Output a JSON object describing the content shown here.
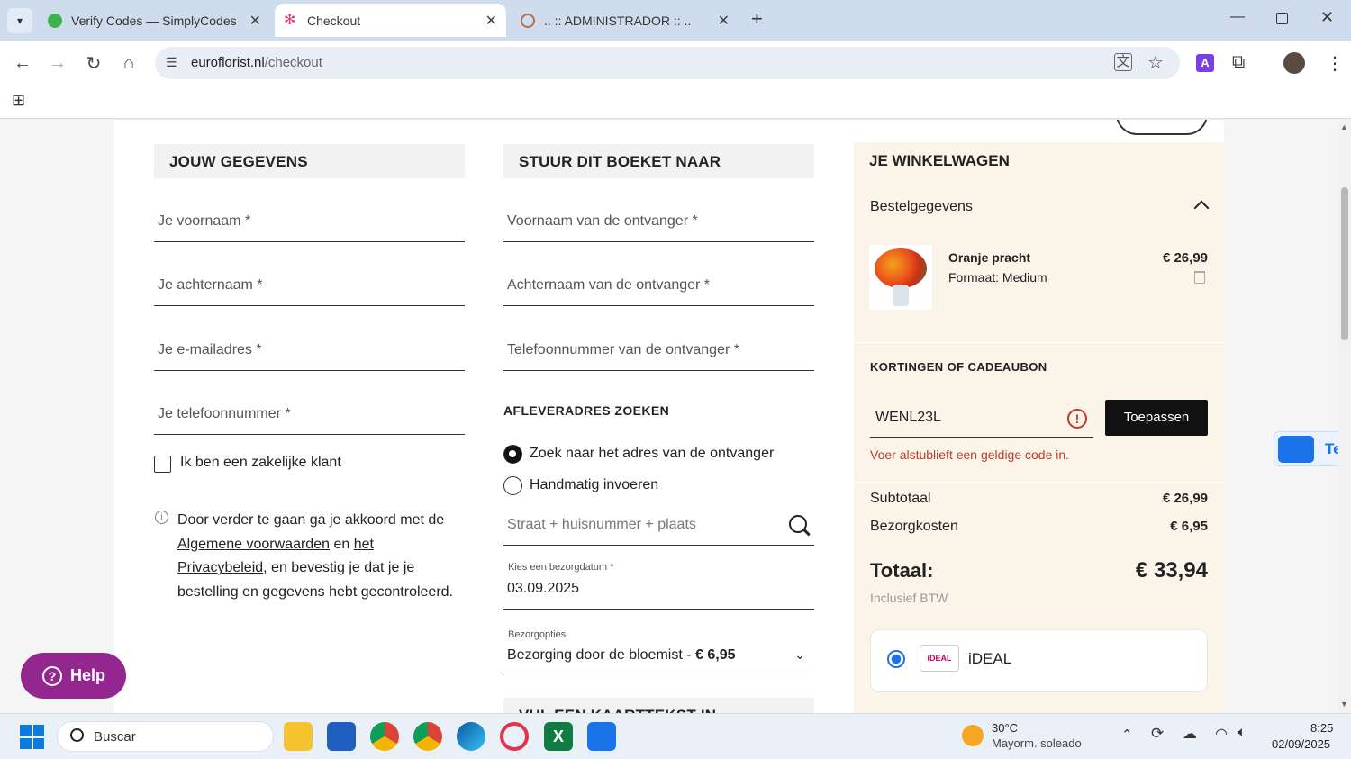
{
  "browser": {
    "tabs": [
      {
        "title": "Verify Codes — SimplyCodes"
      },
      {
        "title": "Checkout"
      },
      {
        "title": ".. :: ADMINISTRADOR :: .."
      }
    ],
    "url_host": "euroflorist.nl",
    "url_path": "/checkout"
  },
  "left": {
    "heading": "JOUW GEGEVENS",
    "fields": [
      "Je voornaam *",
      "Je achternaam *",
      "Je e-mailadres *",
      "Je telefoonnummer *"
    ],
    "business_label": "Ik ben een zakelijke klant",
    "terms_line1": "Door verder te gaan ga je akkoord met de",
    "terms_link1": "Algemene voorwaarden",
    "terms_en": "en",
    "terms_link2a": "het",
    "terms_link2b": "Privacybeleid",
    "terms_rest1": ", en bevestig je dat je je",
    "terms_rest2": "bestelling en gegevens hebt gecontroleerd."
  },
  "middle": {
    "heading": "STUUR DIT BOEKET NAAR",
    "fields": [
      "Voornaam van de ontvanger *",
      "Achternaam van de ontvanger *",
      "Telefoonnummer van de ontvanger *"
    ],
    "address_heading": "AFLEVERADRES ZOEKEN",
    "radio_search": "Zoek naar het adres van de ontvanger",
    "radio_manual": "Handmatig invoeren",
    "street_placeholder": "Straat + huisnummer + plaats",
    "date_label": "Kies een bezorgdatum *",
    "date_value": "03.09.2025",
    "options_label": "Bezorgopties",
    "options_value": "Bezorging door de bloemist -",
    "options_price": "€ 6,95",
    "next_heading": "VUL EEN KAARTTEKST IN"
  },
  "cart": {
    "heading": "JE WINKELWAGEN",
    "details_label": "Bestelgegevens",
    "product_name": "Oranje pracht",
    "product_format": "Formaat: Medium",
    "product_price": "€ 26,99",
    "discount_heading": "KORTINGEN OF CADEAUBON",
    "discount_code": "WENL23L",
    "apply_label": "Toepassen",
    "error_msg": "Voer alstublieft een geldige code in.",
    "subtotal_label": "Subtotaal",
    "subtotal_value": "€ 26,99",
    "shipping_label": "Bezorgkosten",
    "shipping_value": "€ 6,95",
    "total_label": "Totaal:",
    "total_value": "€ 33,94",
    "vat_note": "Inclusief BTW",
    "payment_label": "iDEAL",
    "payment_logo_text": "iDEAL"
  },
  "side_widget_text": "Ter",
  "help_label": "Help",
  "taskbar": {
    "search_placeholder": "Buscar",
    "weather_temp": "30°C",
    "weather_desc": "Mayorm. soleado",
    "time": "8:25",
    "date": "02/09/2025"
  },
  "colors": {
    "accent_purple": "#93278f",
    "error_red": "#c0392b",
    "cart_bg": "#fbf5e9",
    "ideal_pink": "#cc0066"
  }
}
